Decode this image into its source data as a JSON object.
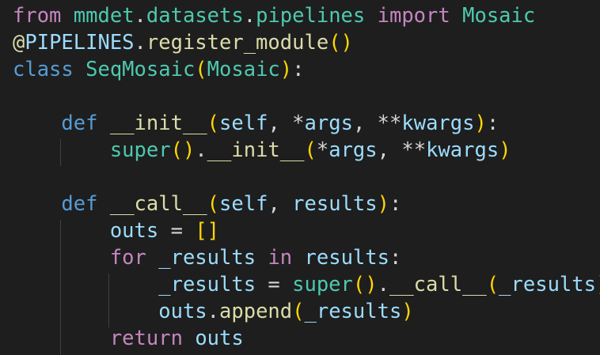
{
  "editor": {
    "lines": [
      [
        {
          "t": "from",
          "c": "kw-ctrl"
        },
        {
          "t": " ",
          "c": "punc"
        },
        {
          "t": "mmdet",
          "c": "mod"
        },
        {
          "t": ".",
          "c": "punc"
        },
        {
          "t": "datasets",
          "c": "mod"
        },
        {
          "t": ".",
          "c": "punc"
        },
        {
          "t": "pipelines",
          "c": "mod"
        },
        {
          "t": " ",
          "c": "punc"
        },
        {
          "t": "import",
          "c": "kw-ctrl"
        },
        {
          "t": " ",
          "c": "punc"
        },
        {
          "t": "Mosaic",
          "c": "cls"
        }
      ],
      [
        {
          "t": "@",
          "c": "dec"
        },
        {
          "t": "PIPELINES",
          "c": "var"
        },
        {
          "t": ".",
          "c": "punc"
        },
        {
          "t": "register_module",
          "c": "fn"
        },
        {
          "t": "()",
          "c": "p1"
        }
      ],
      [
        {
          "t": "class",
          "c": "kw"
        },
        {
          "t": " ",
          "c": "punc"
        },
        {
          "t": "SeqMosaic",
          "c": "cls"
        },
        {
          "t": "(",
          "c": "p1"
        },
        {
          "t": "Mosaic",
          "c": "cls"
        },
        {
          "t": ")",
          "c": "p1"
        },
        {
          "t": ":",
          "c": "punc"
        }
      ],
      [],
      [
        {
          "t": "    ",
          "c": "punc"
        },
        {
          "t": "def",
          "c": "kw"
        },
        {
          "t": " ",
          "c": "punc"
        },
        {
          "t": "__init__",
          "c": "fn"
        },
        {
          "t": "(",
          "c": "p1"
        },
        {
          "t": "self",
          "c": "var"
        },
        {
          "t": ", *",
          "c": "punc"
        },
        {
          "t": "args",
          "c": "var"
        },
        {
          "t": ", **",
          "c": "punc"
        },
        {
          "t": "kwargs",
          "c": "var"
        },
        {
          "t": ")",
          "c": "p1"
        },
        {
          "t": ":",
          "c": "punc"
        }
      ],
      [
        {
          "t": "        ",
          "c": "punc"
        },
        {
          "t": "super",
          "c": "builtin"
        },
        {
          "t": "()",
          "c": "p1"
        },
        {
          "t": ".",
          "c": "punc"
        },
        {
          "t": "__init__",
          "c": "fn"
        },
        {
          "t": "(",
          "c": "p1"
        },
        {
          "t": "*",
          "c": "punc"
        },
        {
          "t": "args",
          "c": "var"
        },
        {
          "t": ", **",
          "c": "punc"
        },
        {
          "t": "kwargs",
          "c": "var"
        },
        {
          "t": ")",
          "c": "p1"
        }
      ],
      [],
      [
        {
          "t": "    ",
          "c": "punc"
        },
        {
          "t": "def",
          "c": "kw"
        },
        {
          "t": " ",
          "c": "punc"
        },
        {
          "t": "__call__",
          "c": "fn"
        },
        {
          "t": "(",
          "c": "p1"
        },
        {
          "t": "self",
          "c": "var"
        },
        {
          "t": ", ",
          "c": "punc"
        },
        {
          "t": "results",
          "c": "var"
        },
        {
          "t": ")",
          "c": "p1"
        },
        {
          "t": ":",
          "c": "punc"
        }
      ],
      [
        {
          "t": "        ",
          "c": "punc"
        },
        {
          "t": "outs",
          "c": "var"
        },
        {
          "t": " = ",
          "c": "punc"
        },
        {
          "t": "[]",
          "c": "p1"
        }
      ],
      [
        {
          "t": "        ",
          "c": "punc"
        },
        {
          "t": "for",
          "c": "kw-ctrl"
        },
        {
          "t": " ",
          "c": "punc"
        },
        {
          "t": "_results",
          "c": "var"
        },
        {
          "t": " ",
          "c": "punc"
        },
        {
          "t": "in",
          "c": "kw-ctrl"
        },
        {
          "t": " ",
          "c": "punc"
        },
        {
          "t": "results",
          "c": "var"
        },
        {
          "t": ":",
          "c": "punc"
        }
      ],
      [
        {
          "t": "            ",
          "c": "punc"
        },
        {
          "t": "_results",
          "c": "var"
        },
        {
          "t": " = ",
          "c": "punc"
        },
        {
          "t": "super",
          "c": "builtin"
        },
        {
          "t": "()",
          "c": "p1"
        },
        {
          "t": ".",
          "c": "punc"
        },
        {
          "t": "__call__",
          "c": "fn"
        },
        {
          "t": "(",
          "c": "p1"
        },
        {
          "t": "_results",
          "c": "var"
        },
        {
          "t": ")",
          "c": "p1"
        }
      ],
      [
        {
          "t": "            ",
          "c": "punc"
        },
        {
          "t": "outs",
          "c": "var"
        },
        {
          "t": ".",
          "c": "punc"
        },
        {
          "t": "append",
          "c": "fn"
        },
        {
          "t": "(",
          "c": "p1"
        },
        {
          "t": "_results",
          "c": "var"
        },
        {
          "t": ")",
          "c": "p1"
        }
      ],
      [
        {
          "t": "        ",
          "c": "punc"
        },
        {
          "t": "return",
          "c": "kw-ctrl"
        },
        {
          "t": " ",
          "c": "punc"
        },
        {
          "t": "outs",
          "c": "var"
        }
      ]
    ]
  }
}
